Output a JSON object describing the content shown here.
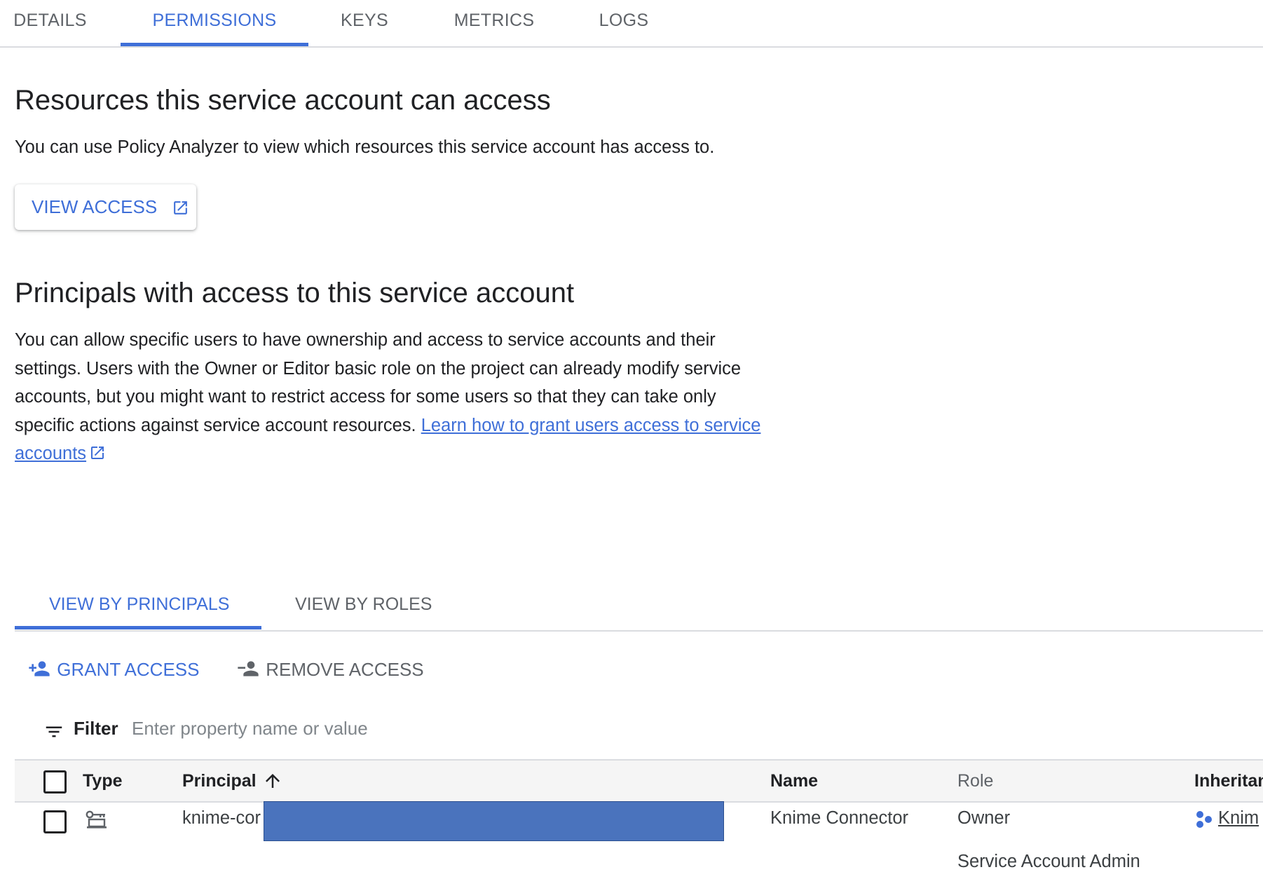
{
  "top_tabs": [
    {
      "label": "DETAILS"
    },
    {
      "label": "PERMISSIONS"
    },
    {
      "label": "KEYS"
    },
    {
      "label": "METRICS"
    },
    {
      "label": "LOGS"
    }
  ],
  "active_top_tab": "PERMISSIONS",
  "resources": {
    "title": "Resources this service account can access",
    "description": "You can use Policy Analyzer to view which resources this service account has access to.",
    "view_access_label": "VIEW ACCESS",
    "view_access_icon": "open-in-new-icon"
  },
  "principals": {
    "title": "Principals with access to this service account",
    "description": "You can allow specific users to have ownership and access to service accounts and their settings. Users with the Owner or Editor basic role on the project can already modify service accounts, but you might want to restrict access for some users so that they can take only specific actions against service account resources.",
    "learn_link": "Learn how to grant users access to service accounts"
  },
  "view_tabs": [
    {
      "label": "VIEW BY PRINCIPALS"
    },
    {
      "label": "VIEW BY ROLES"
    }
  ],
  "actions": {
    "grant": "GRANT ACCESS",
    "remove": "REMOVE ACCESS"
  },
  "filter": {
    "label": "Filter",
    "placeholder": "Enter property name or value"
  },
  "table": {
    "columns": {
      "type": "Type",
      "principal": "Principal",
      "name": "Name",
      "role": "Role",
      "inheritance": "Inheritan"
    },
    "sort_indicator": "ascending",
    "rows": [
      {
        "principal": "knime-cor",
        "name": "Knime Connector",
        "role": "Owner",
        "role_2": "Service Account Admin",
        "inheritance": "Knim",
        "type_icon": "service-account-icon"
      }
    ]
  },
  "colors": {
    "accent": "#3f6fd8",
    "redaction": "#4a73bd",
    "divider": "#dadce0",
    "header_bg": "#f5f5f5"
  }
}
